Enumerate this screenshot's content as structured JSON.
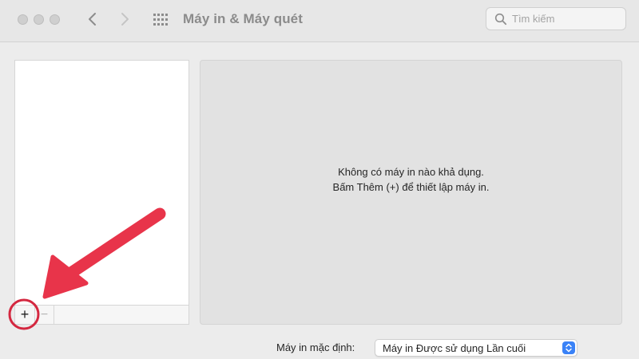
{
  "window": {
    "title": "Máy in & Máy quét"
  },
  "toolbar": {
    "back_icon": "chevron-left-icon",
    "forward_icon": "chevron-right-icon",
    "grid_icon": "grid-icon",
    "search": {
      "placeholder": "Tìm kiếm",
      "value": "",
      "icon": "search-icon"
    }
  },
  "printer_list": {
    "items": [],
    "add_label": "+",
    "remove_label": "−"
  },
  "detail": {
    "empty_line1": "Không có máy in nào khả dụng.",
    "empty_line2": "Bấm Thêm (+) để thiết lập máy in."
  },
  "default_printer": {
    "label": "Máy in mặc định:",
    "selected": "Máy in Được sử dụng Lần cuối"
  },
  "colors": {
    "accent": "#3a82f7",
    "annotation": "#e8344a"
  }
}
